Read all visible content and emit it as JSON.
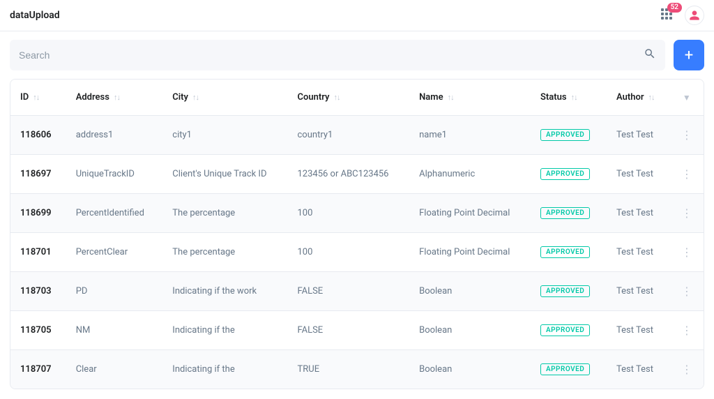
{
  "page_title": "dataUpload",
  "notification_count": "52",
  "search": {
    "placeholder": "Search"
  },
  "columns": [
    {
      "key": "id",
      "label": "ID",
      "sortable": true
    },
    {
      "key": "address",
      "label": "Address",
      "sortable": true
    },
    {
      "key": "city",
      "label": "City",
      "sortable": true
    },
    {
      "key": "country",
      "label": "Country",
      "sortable": true
    },
    {
      "key": "name",
      "label": "Name",
      "sortable": true
    },
    {
      "key": "status",
      "label": "Status",
      "sortable": true
    },
    {
      "key": "author",
      "label": "Author",
      "sortable": true
    }
  ],
  "rows": [
    {
      "id": "118606",
      "address": "address1",
      "city": "city1",
      "country": "country1",
      "name": "name1",
      "status": "APPROVED",
      "author": "Test Test"
    },
    {
      "id": "118697",
      "address": "UniqueTrackID",
      "city": "Client's Unique Track ID",
      "country": "123456 or ABC123456",
      "name": "Alphanumeric",
      "status": "APPROVED",
      "author": "Test Test"
    },
    {
      "id": "118699",
      "address": "PercentIdentified",
      "city": "The percentage",
      "country": "100",
      "name": "Floating Point Decimal",
      "status": "APPROVED",
      "author": "Test Test"
    },
    {
      "id": "118701",
      "address": "PercentClear",
      "city": "The percentage",
      "country": "100",
      "name": "Floating Point Decimal",
      "status": "APPROVED",
      "author": "Test Test"
    },
    {
      "id": "118703",
      "address": "PD",
      "city": "Indicating if the work",
      "country": "FALSE",
      "name": "Boolean",
      "status": "APPROVED",
      "author": "Test Test"
    },
    {
      "id": "118705",
      "address": "NM",
      "city": "Indicating if the",
      "country": "FALSE",
      "name": "Boolean",
      "status": "APPROVED",
      "author": "Test Test"
    },
    {
      "id": "118707",
      "address": "Clear",
      "city": "Indicating if the",
      "country": "TRUE",
      "name": "Boolean",
      "status": "APPROVED",
      "author": "Test Test"
    }
  ]
}
